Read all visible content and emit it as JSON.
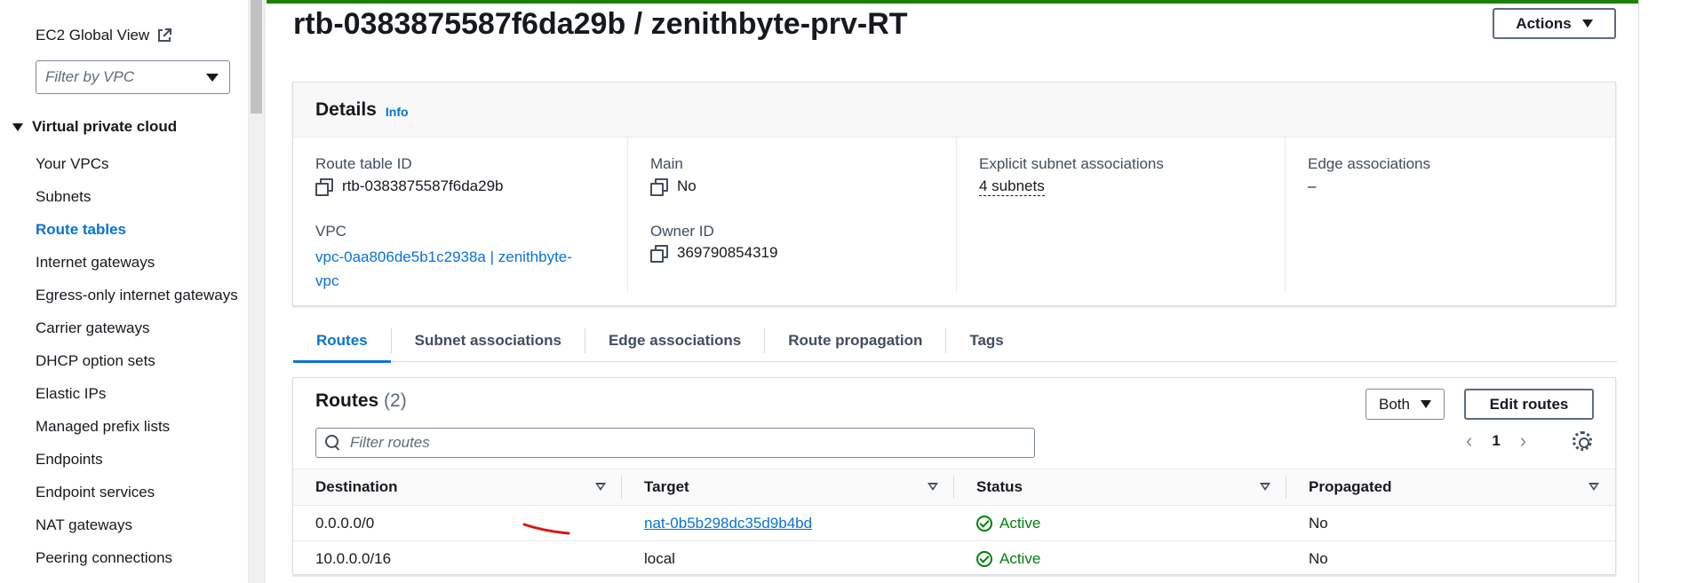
{
  "sidebar": {
    "global_view": "EC2 Global View",
    "filter_placeholder": "Filter by VPC",
    "section": "Virtual private cloud",
    "items": [
      {
        "label": "Your VPCs",
        "active": false
      },
      {
        "label": "Subnets",
        "active": false
      },
      {
        "label": "Route tables",
        "active": true
      },
      {
        "label": "Internet gateways",
        "active": false
      },
      {
        "label": "Egress-only internet gateways",
        "active": false
      },
      {
        "label": "Carrier gateways",
        "active": false
      },
      {
        "label": "DHCP option sets",
        "active": false
      },
      {
        "label": "Elastic IPs",
        "active": false
      },
      {
        "label": "Managed prefix lists",
        "active": false
      },
      {
        "label": "Endpoints",
        "active": false
      },
      {
        "label": "Endpoint services",
        "active": false
      },
      {
        "label": "NAT gateways",
        "active": false
      },
      {
        "label": "Peering connections",
        "active": false
      }
    ]
  },
  "header": {
    "title": "rtb-0383875587f6da29b / zenithbyte-prv-RT",
    "actions_label": "Actions"
  },
  "details": {
    "title": "Details",
    "info": "Info",
    "route_table_id_label": "Route table ID",
    "route_table_id": "rtb-0383875587f6da29b",
    "vpc_label": "VPC",
    "vpc_line1": "vpc-0aa806de5b1c2938a | zenithbyte-",
    "vpc_line2": "vpc",
    "main_label": "Main",
    "main_value": "No",
    "owner_label": "Owner ID",
    "owner_value": "369790854319",
    "explicit_label": "Explicit subnet associations",
    "explicit_value": "4 subnets",
    "edge_label": "Edge associations",
    "edge_value": "–"
  },
  "tabs": [
    "Routes",
    "Subnet associations",
    "Edge associations",
    "Route propagation",
    "Tags"
  ],
  "routes": {
    "title": "Routes",
    "count": "(2)",
    "both_label": "Both",
    "edit_label": "Edit routes",
    "filter_placeholder": "Filter routes",
    "page": "1",
    "columns": [
      "Destination",
      "Target",
      "Status",
      "Propagated"
    ],
    "rows": [
      {
        "destination": "0.0.0.0/0",
        "target": "nat-0b5b298dc35d9b4bd",
        "target_link": true,
        "status": "Active",
        "propagated": "No"
      },
      {
        "destination": "10.0.0.0/16",
        "target": "local",
        "target_link": false,
        "status": "Active",
        "propagated": "No"
      }
    ]
  },
  "colors": {
    "accent": "#0972d3",
    "success": "#037f0c",
    "banner": "#1d8102",
    "annotation": "#d91515"
  }
}
